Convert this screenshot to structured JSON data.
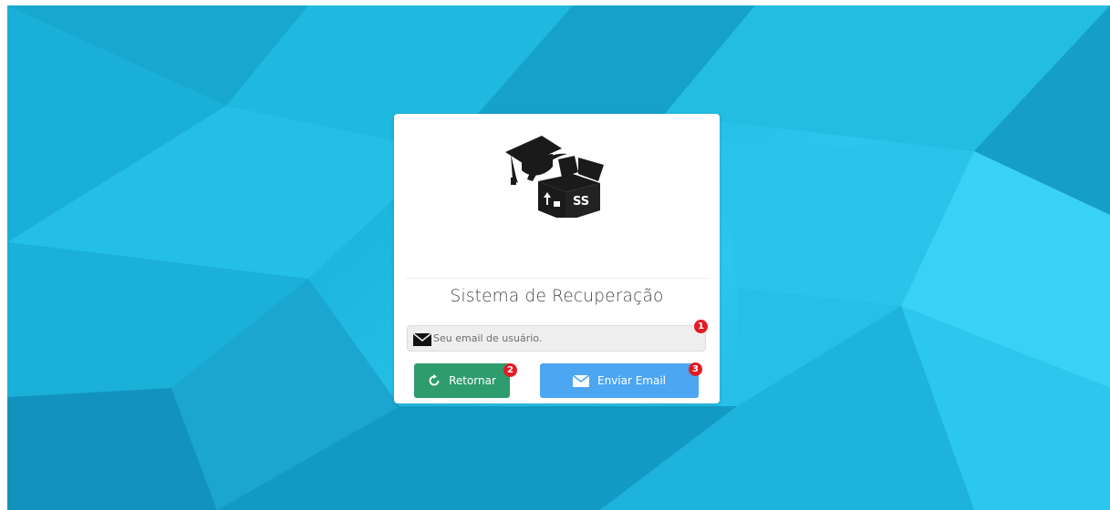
{
  "title": "Sistema de Recuperação",
  "email_input": {
    "placeholder": "Seu email de usuário.",
    "value": ""
  },
  "buttons": {
    "return_label": "Retornar",
    "send_label": "Enviar Email"
  },
  "badges": [
    "1",
    "2",
    "3"
  ],
  "icons": {
    "logo": "graduation-cap-box-logo",
    "input": "envelope-icon",
    "return": "refresh-icon",
    "send": "envelope-icon"
  },
  "colors": {
    "background": "#1cb5dd",
    "return_button": "#2f9c6d",
    "send_button": "#4da6f2",
    "badge": "#e31b23"
  }
}
